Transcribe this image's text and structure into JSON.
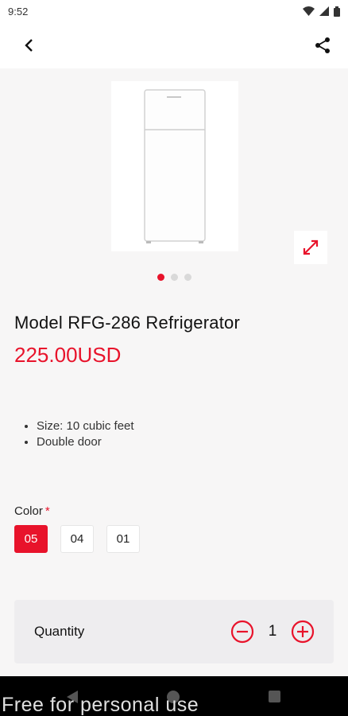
{
  "status_bar": {
    "time": "9:52"
  },
  "product": {
    "title": "Model RFG-286 Refrigerator",
    "price": "225.00USD",
    "specs": [
      "Size: 10 cubic feet",
      "Double door"
    ],
    "gallery": {
      "page_count": 3,
      "active_index": 0
    }
  },
  "color": {
    "label": "Color",
    "required_mark": "*",
    "options": [
      "05",
      "04",
      "01"
    ],
    "selected": "05"
  },
  "quantity": {
    "label": "Quantity",
    "value": "1"
  },
  "watermark": "Free for personal use",
  "theme": {
    "accent": "#e8132b"
  }
}
